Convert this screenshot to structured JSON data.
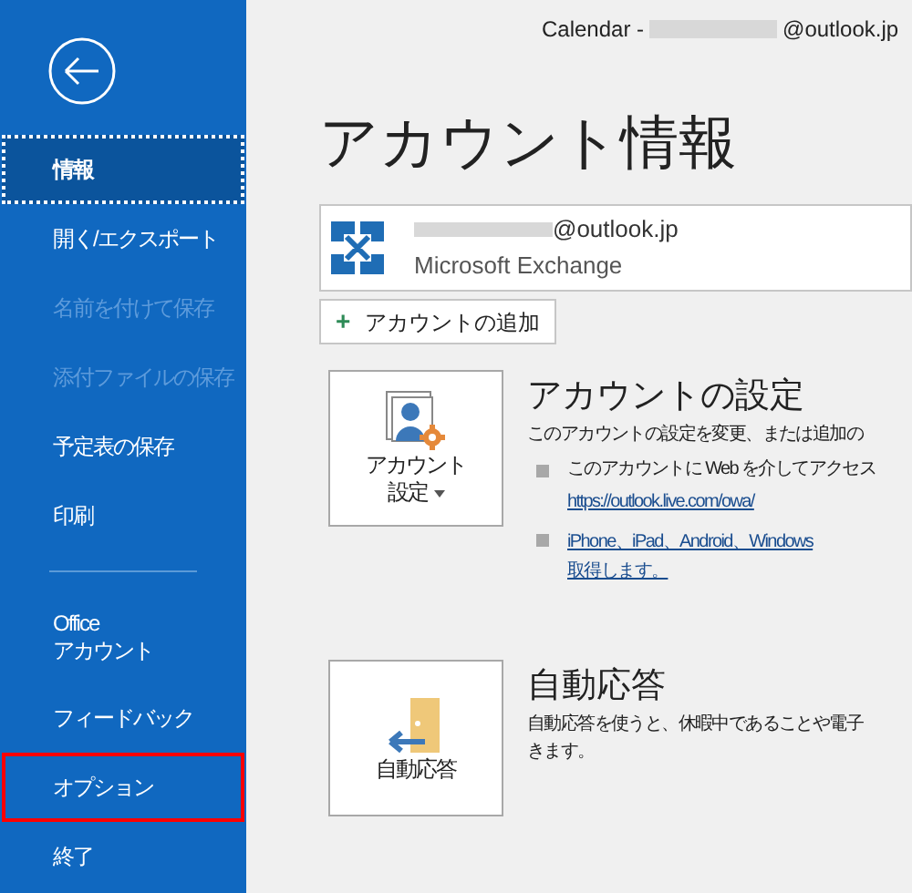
{
  "window": {
    "title_prefix": "Calendar -",
    "title_suffix": "@outlook.jp"
  },
  "sidebar": {
    "items": [
      {
        "kind": "item",
        "label": "情報",
        "selected": true,
        "disabled": false,
        "highlighted": false
      },
      {
        "kind": "item",
        "label": "開く/エクスポート",
        "selected": false,
        "disabled": false,
        "highlighted": false
      },
      {
        "kind": "item",
        "label": "名前を付けて保存",
        "selected": false,
        "disabled": true,
        "highlighted": false
      },
      {
        "kind": "item",
        "label": "添付ファイルの保存",
        "selected": false,
        "disabled": true,
        "highlighted": false
      },
      {
        "kind": "item",
        "label": "予定表の保存",
        "selected": false,
        "disabled": false,
        "highlighted": false
      },
      {
        "kind": "item",
        "label": "印刷",
        "selected": false,
        "disabled": false,
        "highlighted": false
      },
      {
        "kind": "separator"
      },
      {
        "kind": "item",
        "label": "Office\nアカウント",
        "selected": false,
        "disabled": false,
        "highlighted": false
      },
      {
        "kind": "item",
        "label": "フィードバック",
        "selected": false,
        "disabled": false,
        "highlighted": false
      },
      {
        "kind": "item",
        "label": "オプション",
        "selected": false,
        "disabled": false,
        "highlighted": true
      },
      {
        "kind": "item",
        "label": "終了",
        "selected": false,
        "disabled": false,
        "highlighted": false
      }
    ]
  },
  "page_title": "アカウント情報",
  "account": {
    "email_suffix": "@outlook.jp",
    "type": "Microsoft Exchange"
  },
  "add_account": {
    "icon": "+",
    "label": "アカウントの追加"
  },
  "sections": [
    {
      "kind": "account_settings",
      "button": [
        "アカウント",
        "設定"
      ],
      "heading": "アカウントの設定",
      "description": [
        "このアカウントの設定を変更、または追加の"
      ],
      "bullets": [
        {
          "text": "このアカウントに Web を介してアクセス",
          "link": [
            "https://outlook.live.com/owa/"
          ]
        },
        {
          "link": [
            "iPhone、iPad、Android、Windows",
            "取得します。"
          ]
        }
      ]
    },
    {
      "kind": "auto_reply",
      "button": [
        "自動応答"
      ],
      "heading": "自動応答",
      "description": [
        "自動応答を使うと、休暇中であることや電子",
        "きます。"
      ]
    }
  ]
}
